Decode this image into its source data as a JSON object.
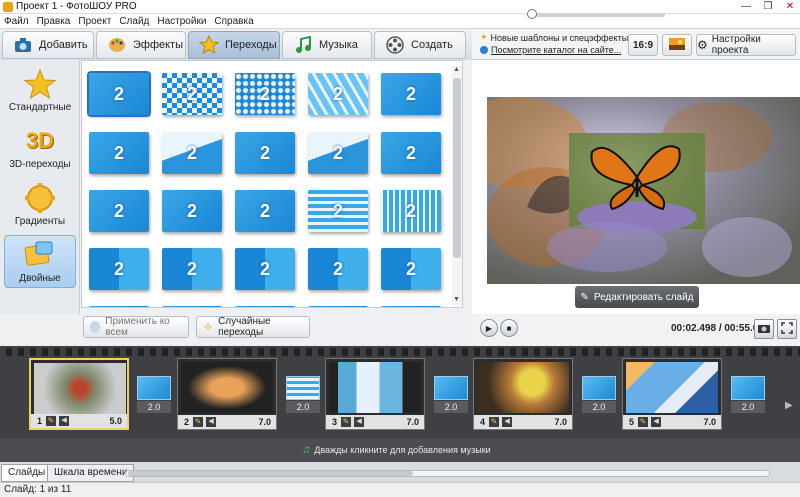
{
  "window": {
    "title": "Проект 1 - ФотоШОУ PRO",
    "controls": [
      "—",
      "❐",
      "✕"
    ]
  },
  "menu": [
    "Файл",
    "Правка",
    "Проект",
    "Слайд",
    "Настройки",
    "Справка"
  ],
  "tabs": [
    {
      "label": "Добавить",
      "icon": "camera-icon"
    },
    {
      "label": "Эффекты",
      "icon": "palette-icon"
    },
    {
      "label": "Переходы",
      "icon": "star-icon",
      "active": true
    },
    {
      "label": "Музыка",
      "icon": "music-note-icon"
    },
    {
      "label": "Создать",
      "icon": "film-reel-icon"
    }
  ],
  "header_links": {
    "new_templates": "Новые шаблоны и спецэффекты",
    "catalog": "Посмотрите каталог на сайте..."
  },
  "aspect_ratio": "16:9",
  "project_settings": "Настройки проекта",
  "categories": [
    {
      "label": "Стандартные",
      "icon": "star-icon"
    },
    {
      "label": "3D-переходы",
      "icon": "3d-icon",
      "icon_text": "3D"
    },
    {
      "label": "Градиенты",
      "icon": "gradient-icon"
    },
    {
      "label": "Двойные",
      "icon": "double-icon",
      "active": true
    }
  ],
  "transitions": {
    "thumb_label": "2",
    "count_visible": 25
  },
  "grid_buttons": {
    "apply_all": "Применить ко всем",
    "random": "Случайные переходы"
  },
  "preview": {
    "edit_slide": "Редактировать слайд"
  },
  "player": {
    "time": "00:02.498 / 00:55.000",
    "progress": 0.0
  },
  "slides": [
    {
      "number": "1",
      "duration": "5.0"
    },
    {
      "number": "2",
      "duration": "7.0"
    },
    {
      "number": "3",
      "duration": "7.0"
    },
    {
      "number": "4",
      "duration": "7.0"
    },
    {
      "number": "5",
      "duration": "7.0"
    }
  ],
  "transition_durations": [
    "2.0",
    "2.0",
    "2.0",
    "2.0",
    "2.0"
  ],
  "music_hint": "Дважды кликните для добавления музыки",
  "bottom_tabs": [
    "Слайды",
    "Шкала времени"
  ],
  "status": "Слайд: 1 из 11",
  "colors": {
    "accent": "#2a7fd4",
    "film": "#3f4043",
    "selection": "#f0d060"
  }
}
